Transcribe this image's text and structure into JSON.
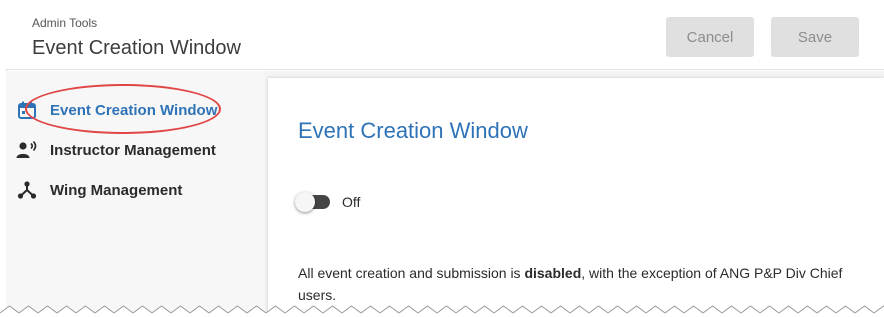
{
  "header": {
    "breadcrumb": "Admin Tools",
    "title": "Event Creation Window",
    "cancel_label": "Cancel",
    "save_label": "Save"
  },
  "sidebar": {
    "items": [
      {
        "label": "Event Creation Window",
        "icon": "calendar-icon",
        "active": true
      },
      {
        "label": "Instructor Management",
        "icon": "instructor-icon",
        "active": false
      },
      {
        "label": "Wing Management",
        "icon": "wing-hierarchy-icon",
        "active": false
      }
    ]
  },
  "main": {
    "section_title": "Event Creation Window",
    "toggle": {
      "label": "Off",
      "state": "off"
    },
    "notice": {
      "prefix": "All event creation and submission is ",
      "emphasis": "disabled",
      "suffix": ", with the exception of ANG P&P Div Chief users."
    }
  },
  "colors": {
    "accent": "#2f73b7",
    "highlight_ring": "#e04646",
    "button_disabled_bg": "#e0e0e0"
  }
}
